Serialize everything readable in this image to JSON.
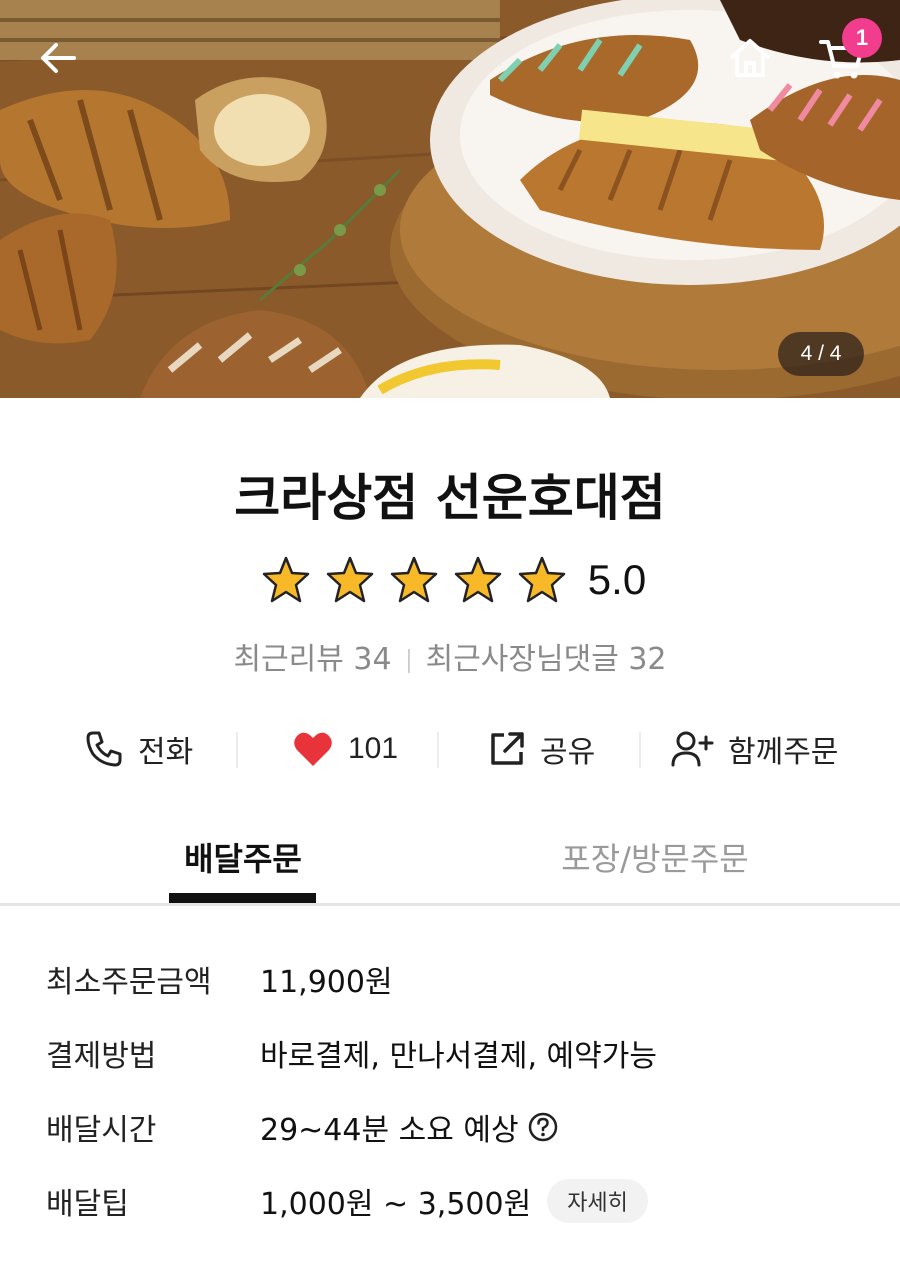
{
  "hero": {
    "page_indicator": "4 / 4",
    "cart_count": "1"
  },
  "store": {
    "name": "크라상점 선운호대점",
    "rating": "5.0",
    "stars": 5,
    "recent_reviews": "최근리뷰 34",
    "owner_replies": "최근사장님댓글 32"
  },
  "actions": {
    "call": "전화",
    "likes": "101",
    "share": "공유",
    "group_order": "함께주문"
  },
  "tabs": [
    {
      "label": "배달주문",
      "active": true
    },
    {
      "label": "포장/방문주문",
      "active": false
    }
  ],
  "info": {
    "min_order": {
      "label": "최소주문금액",
      "value": "11,900원"
    },
    "payment": {
      "label": "결제방법",
      "value": "바로결제, 만나서결제, 예약가능"
    },
    "delivery_time": {
      "label": "배달시간",
      "value": "29~44분 소요 예상"
    },
    "delivery_tip": {
      "label": "배달팁",
      "value": "1,000원 ~ 3,500원",
      "detail": "자세히"
    }
  },
  "colors": {
    "badge": "#f23d8e",
    "heart": "#e8333a",
    "star": "#f7b928"
  }
}
